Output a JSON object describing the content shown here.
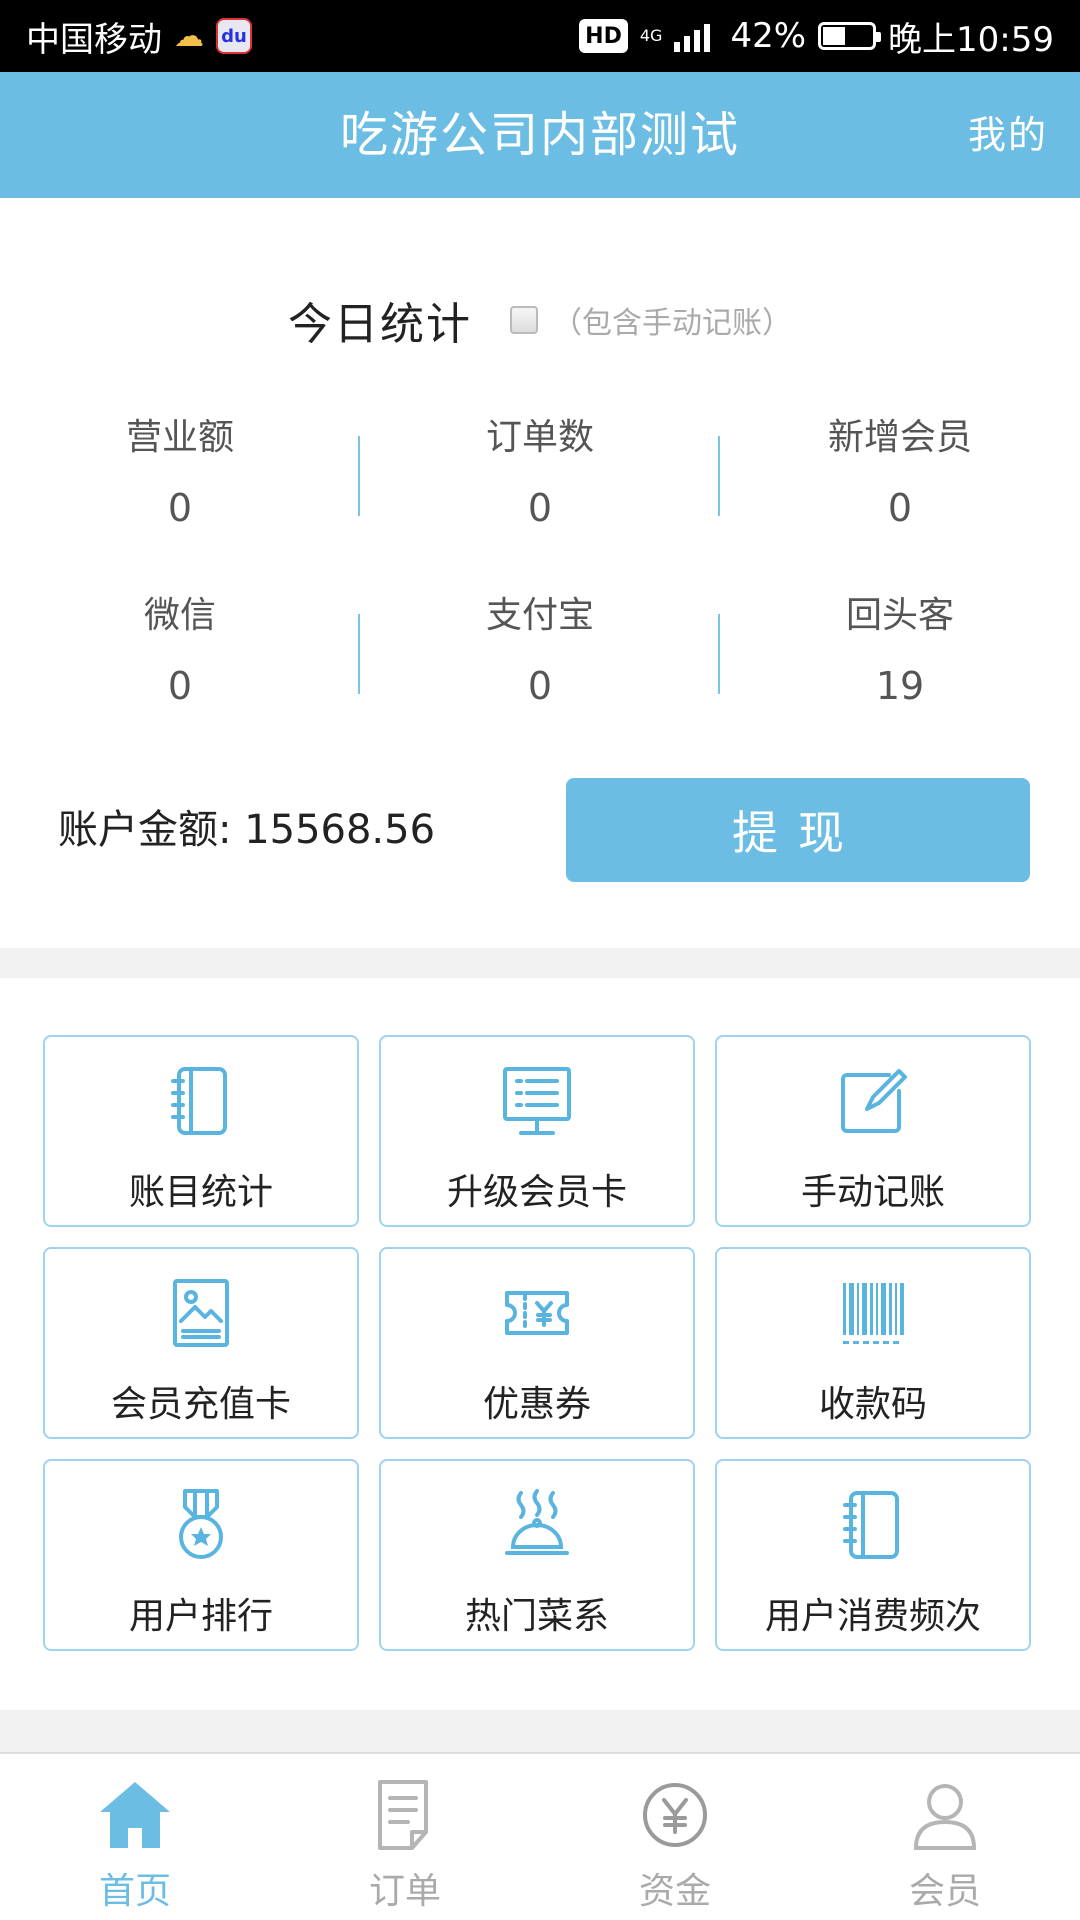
{
  "status_bar": {
    "carrier": "中国移动",
    "hd": "HD",
    "network": "4G",
    "battery": "42%",
    "time": "晚上10:59"
  },
  "header": {
    "title": "吃游公司内部测试",
    "mine": "我的"
  },
  "stats": {
    "title": "今日统计",
    "manual_note": "（包含手动记账）",
    "items": [
      {
        "label": "营业额",
        "value": "0"
      },
      {
        "label": "订单数",
        "value": "0"
      },
      {
        "label": "新增会员",
        "value": "0"
      },
      {
        "label": "微信",
        "value": "0"
      },
      {
        "label": "支付宝",
        "value": "0"
      },
      {
        "label": "回头客",
        "value": "19"
      }
    ],
    "account_label": "账户金额: 15568.56",
    "withdraw_label": "提现"
  },
  "functions": [
    {
      "label": "账目统计",
      "icon": "notebook-icon"
    },
    {
      "label": "升级会员卡",
      "icon": "monitor-list-icon"
    },
    {
      "label": "手动记账",
      "icon": "edit-icon"
    },
    {
      "label": "会员充值卡",
      "icon": "picture-card-icon"
    },
    {
      "label": "优惠券",
      "icon": "coupon-icon"
    },
    {
      "label": "收款码",
      "icon": "barcode-icon"
    },
    {
      "label": "用户排行",
      "icon": "medal-icon"
    },
    {
      "label": "热门菜系",
      "icon": "food-cloche-icon"
    },
    {
      "label": "用户消费频次",
      "icon": "notebook-icon"
    }
  ],
  "tabs": [
    {
      "label": "首页",
      "icon": "home-icon"
    },
    {
      "label": "订单",
      "icon": "document-icon"
    },
    {
      "label": "资金",
      "icon": "yen-coin-icon"
    },
    {
      "label": "会员",
      "icon": "user-icon"
    }
  ],
  "colors": {
    "accent": "#6bbde4",
    "tile_border": "#9fd3ef",
    "inactive_tab": "#aaaaaa"
  }
}
